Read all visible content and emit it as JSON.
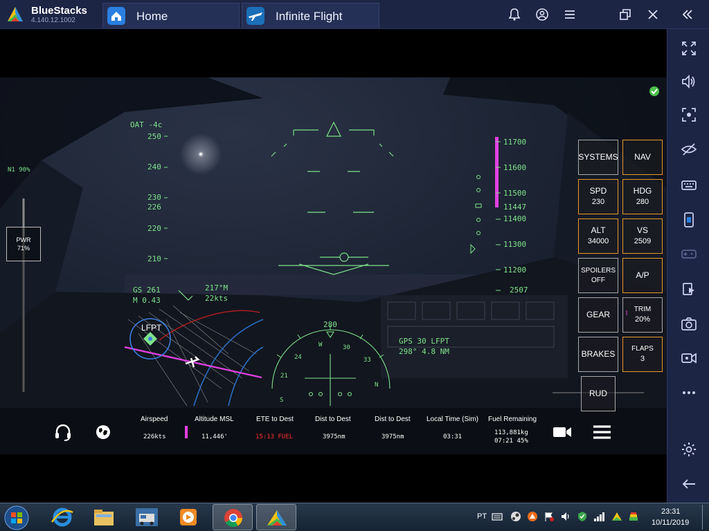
{
  "window": {
    "app_name": "BlueStacks",
    "version": "4.140.12.1002",
    "tabs": [
      {
        "label": "Home"
      },
      {
        "label": "Infinite Flight"
      }
    ]
  },
  "hud": {
    "oat": "OAT -4c",
    "n1": "N1  90%",
    "pwr_label": "PWR",
    "pwr_value": "71%",
    "speed_ticks": [
      "250",
      "240",
      "230",
      "220",
      "210"
    ],
    "current_speed": "226",
    "gs": "GS 261",
    "mach": "M 0.43",
    "wind_dir": "217°M",
    "wind_speed": "22kts",
    "alt_ticks": [
      "11700",
      "11600",
      "11500",
      "11447",
      "11400",
      "11300",
      "11200"
    ],
    "vs_value": "2507",
    "heading": "280",
    "gps": "GPS 30 LFPT",
    "gps_detail": "298° 4.8 NM",
    "compass_labels": [
      "W",
      "30",
      "33",
      "N",
      "24",
      "21",
      "S"
    ],
    "airport": "LFPT"
  },
  "panel": {
    "systems": "SYSTEMS",
    "nav": "NAV",
    "spd_label": "SPD",
    "spd_value": "230",
    "hdg_label": "HDG",
    "hdg_value": "280",
    "alt_label": "ALT",
    "alt_value": "34000",
    "vs_label": "VS",
    "vs_value": "2509",
    "spoilers_label": "SPOILERS",
    "spoilers_value": "OFF",
    "ap": "A/P",
    "gear": "GEAR",
    "trim_label": "TRIM",
    "trim_value": "20%",
    "brakes": "BRAKES",
    "flaps_label": "FLAPS",
    "flaps_value": "3",
    "rud": "RUD"
  },
  "info_bar": {
    "headers": [
      "Airspeed",
      "Altitude MSL",
      "ETE to Dest",
      "Dist to Dest",
      "Dist to Dest",
      "Local Time (Sim)",
      "Fuel Remaining"
    ],
    "values": [
      "226kts",
      "11,446'",
      "15:13 FUEL",
      "3975nm",
      "3975nm",
      "03:31"
    ],
    "fuel_line1": "113,881kg",
    "fuel_line2": "07:21 45%"
  },
  "tray": {
    "lang": "PT",
    "time": "23:31",
    "date": "10/11/2019"
  },
  "colors": {
    "hud_green": "#7ee28a",
    "magenta": "#e040e0",
    "orange_border": "#e89a2a",
    "titlebar": "#1d2545"
  }
}
